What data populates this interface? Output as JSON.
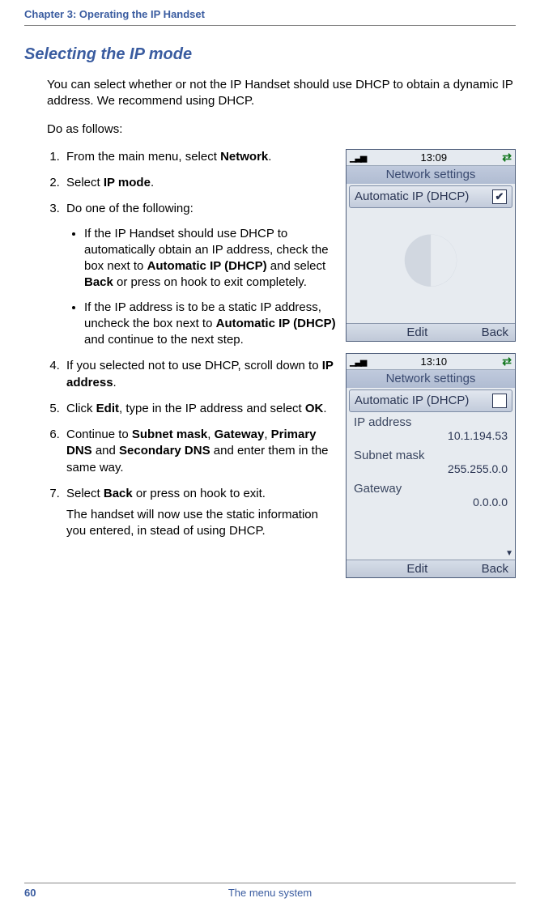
{
  "header": {
    "chapter": "Chapter 3:  Operating the IP Handset"
  },
  "section": {
    "title": "Selecting the IP mode"
  },
  "intro": {
    "p1": "You can select whether or not the IP Handset should use DHCP to obtain a dynamic IP address. We recommend using DHCP.",
    "p2": "Do as follows:"
  },
  "steps": {
    "s1_a": "From the main menu, select ",
    "s1_b": "Network",
    "s1_c": ".",
    "s2_a": "Select ",
    "s2_b": "IP mode",
    "s2_c": ".",
    "s3": "Do one of the following:",
    "s3_b1_a": "If the IP Handset should use DHCP to automatically obtain an IP address, check the box next to ",
    "s3_b1_b": "Automatic IP (DHCP)",
    "s3_b1_c": " and select ",
    "s3_b1_d": "Back",
    "s3_b1_e": " or press on hook to exit completely.",
    "s3_b2_a": "If the IP address is to be a static IP address, uncheck the box next to ",
    "s3_b2_b": "Automatic IP (DHCP)",
    "s3_b2_c": " and continue to the next step.",
    "s4_a": "If you selected not to use DHCP, scroll down to ",
    "s4_b": "IP address",
    "s4_c": ".",
    "s5_a": "Click ",
    "s5_b": "Edit",
    "s5_c": ", type in the IP address and select ",
    "s5_d": "OK",
    "s5_e": ".",
    "s6_a": "Continue to ",
    "s6_b": "Subnet mask",
    "s6_c": ", ",
    "s6_d": "Gateway",
    "s6_e": ", ",
    "s6_f": "Primary DNS",
    "s6_g": " and ",
    "s6_h": "Secondary DNS",
    "s6_i": " and enter them in the same way.",
    "s7_a": "Select ",
    "s7_b": "Back",
    "s7_c": " or press on hook to exit.",
    "s7_extra": "The handset will now use the static information you entered, in stead of using DHCP."
  },
  "phone1": {
    "time": "13:09",
    "title": "Network settings",
    "item": "Automatic IP (DHCP)",
    "check": "✔",
    "soft_center": "Edit",
    "soft_right": "Back"
  },
  "phone2": {
    "time": "13:10",
    "title": "Network settings",
    "item": "Automatic IP (DHCP)",
    "ip_label": "IP address",
    "ip_value": "10.1.194.53",
    "sm_label": "Subnet mask",
    "sm_value": "255.255.0.0",
    "gw_label": "Gateway",
    "gw_value": "0.0.0.0",
    "soft_center": "Edit",
    "soft_right": "Back"
  },
  "footer": {
    "page": "60",
    "title": "The menu system"
  }
}
